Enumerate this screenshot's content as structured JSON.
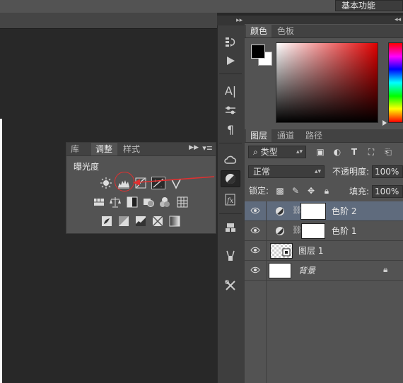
{
  "workspace": {
    "label": "基本功能"
  },
  "adjustments_panel": {
    "tabs": [
      "库",
      "调整",
      "样式"
    ],
    "title": "曝光度",
    "icons_row1": [
      "brightness-contrast-icon",
      "levels-icon",
      "curves-icon",
      "exposure-icon",
      "vibrance-icon"
    ],
    "icons_row2": [
      "hue-saturation-icon",
      "color-balance-icon",
      "black-white-icon",
      "photo-filter-icon",
      "channel-mixer-icon",
      "color-lookup-icon"
    ],
    "icons_row3": [
      "invert-icon",
      "posterize-icon",
      "threshold-icon",
      "selective-color-icon",
      "gradient-map-icon"
    ]
  },
  "color_panel": {
    "tabs": [
      "颜色",
      "色板"
    ],
    "foreground": "#000000",
    "background": "#ffffff"
  },
  "layers_panel": {
    "tabs": [
      "图层",
      "通道",
      "路径"
    ],
    "filter_label": "类型",
    "blend_mode": "正常",
    "opacity_label": "不透明度:",
    "opacity_value": "100%",
    "lock_label": "锁定:",
    "fill_label": "填充:",
    "fill_value": "100%",
    "layers": [
      {
        "name": "色阶 2",
        "selected": true
      },
      {
        "name": "色阶 1",
        "selected": false
      },
      {
        "name": "图层 1",
        "selected": false
      },
      {
        "name": "背景",
        "selected": false
      }
    ]
  },
  "colors": {
    "annotation_red": "#e03030",
    "selected_row": "#5f6b7d"
  }
}
